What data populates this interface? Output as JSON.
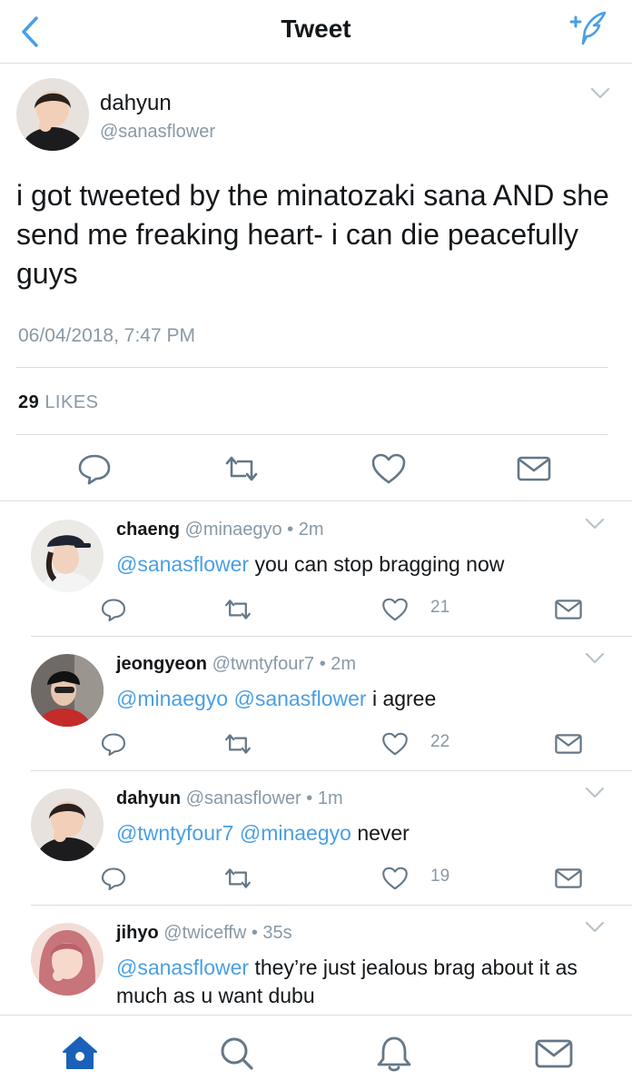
{
  "nav": {
    "title": "Tweet",
    "back_icon": "chevron-left-icon",
    "compose_icon": "compose-tweet-icon"
  },
  "tweet": {
    "name": "dahyun",
    "handle": "@sanasflower",
    "text": "i got tweeted by the minatozaki sana AND she send me freaking heart- i can die peacefully guys",
    "timestamp": "06/04/2018, 7:47 PM",
    "likes_count": "29",
    "likes_label": "LIKES"
  },
  "replies": [
    {
      "name": "chaeng",
      "meta": "@minaegyo • 2m",
      "mentions": "@sanasflower",
      "text": "you can stop bragging now",
      "likes": "21"
    },
    {
      "name": "jeongyeon",
      "meta": "@twntyfour7 • 2m",
      "mentions": "@minaegyo @sanasflower",
      "text": "i agree",
      "likes": "22"
    },
    {
      "name": "dahyun",
      "meta": "@sanasflower • 1m",
      "mentions": "@twntyfour7 @minaegyo",
      "text": "never",
      "likes": "19"
    },
    {
      "name": "jihyo",
      "meta": "@twiceffw • 35s",
      "mentions": "@sanasflower",
      "text": "they’re just jealous brag about it as much as u want dubu",
      "likes": ""
    }
  ],
  "colors": {
    "accent": "#4a9fe4",
    "secondary_text": "#8899a6",
    "divider": "#d8dde2",
    "tab_active": "#1b61b9"
  },
  "tabs": [
    "home-icon",
    "search-icon",
    "notifications-icon",
    "messages-icon"
  ]
}
